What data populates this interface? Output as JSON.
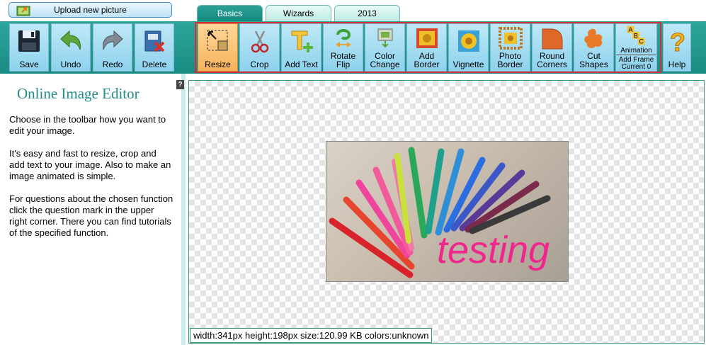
{
  "upload": {
    "label": "Upload new picture",
    "icon": "upload-image-icon"
  },
  "tabs": [
    {
      "label": "Basics",
      "active": true
    },
    {
      "label": "Wizards",
      "active": false
    },
    {
      "label": "2013",
      "active": false
    }
  ],
  "toolbar": {
    "file_buttons": [
      {
        "label": "Save",
        "icon": "floppy-disk-icon"
      },
      {
        "label": "Undo",
        "icon": "undo-arrow-icon"
      },
      {
        "label": "Redo",
        "icon": "redo-arrow-icon"
      },
      {
        "label": "Delete",
        "icon": "delete-file-icon"
      }
    ],
    "tools": [
      {
        "label": "Resize",
        "icon": "resize-icon",
        "selected": true
      },
      {
        "label": "Crop",
        "icon": "scissors-icon",
        "selected": false
      },
      {
        "label": "Add Text",
        "icon": "add-text-icon",
        "selected": false
      },
      {
        "label_1": "Rotate",
        "label_2": "Flip",
        "icon": "rotate-flip-icon",
        "selected": false
      },
      {
        "label_1": "Color",
        "label_2": "Change",
        "icon": "color-change-icon",
        "selected": false
      },
      {
        "label_1": "Add",
        "label_2": "Border",
        "icon": "add-border-icon",
        "selected": false
      },
      {
        "label": "Vignette",
        "icon": "vignette-icon",
        "selected": false
      },
      {
        "label_1": "Photo",
        "label_2": "Border",
        "icon": "photo-border-icon",
        "selected": false
      },
      {
        "label_1": "Round",
        "label_2": "Corners",
        "icon": "round-corners-icon",
        "selected": false
      },
      {
        "label_1": "Cut",
        "label_2": "Shapes",
        "icon": "cut-shapes-icon",
        "selected": false
      }
    ],
    "animation": {
      "title": "Animation",
      "line_1": "Add Frame",
      "line_2": "Current 0",
      "icon": "abc-animation-icon"
    },
    "help": {
      "label": "Help",
      "icon": "question-mark-icon"
    }
  },
  "sidebar": {
    "title": "Online Image Editor",
    "help_mark": "?",
    "paragraphs": [
      "Choose in the toolbar how you want to edit your image.",
      "It's easy and fast to resize, crop and add text to your image. Also to make an image animated is simple.",
      "For questions about the chosen function click the question mark in the upper right corner. There you can find tutorials of the specified function."
    ]
  },
  "image": {
    "overlay_text": "testing",
    "text_color": "#f0268e"
  },
  "status": {
    "text": "width:341px  height:198px  size:120.99 KB  colors:unknown"
  },
  "colors": {
    "accent": "#1a8e84",
    "selection_outline": "#d92b3a",
    "selected_tool": "#f6b35a"
  }
}
